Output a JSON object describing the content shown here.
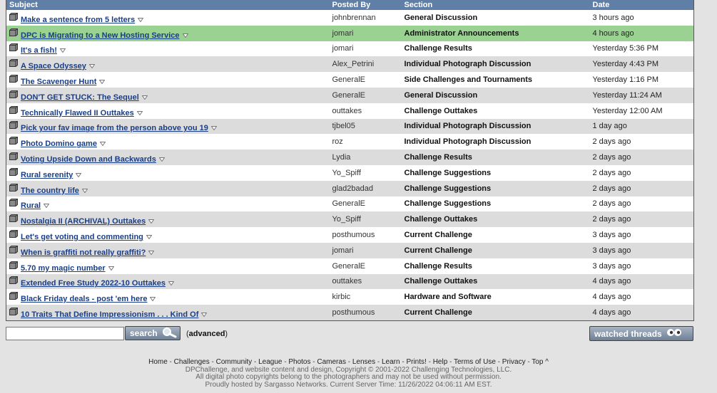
{
  "headers": {
    "subject": "Subject",
    "posted_by": "Posted By",
    "section": "Section",
    "date": "Date"
  },
  "threads": [
    {
      "subject": "Make a sentence from 5 letters",
      "poster": "johnbrennan",
      "section": "General Discussion",
      "date": "3 hours ago"
    },
    {
      "subject": "DPC is Migrating to a New Hosting Service",
      "poster": "jomari",
      "section": "Administrator Announcements",
      "date": "4 hours ago",
      "highlight": true
    },
    {
      "subject": "It's a fish!",
      "poster": "jomari",
      "section": "Challenge Results",
      "date": "Yesterday 5:36 PM"
    },
    {
      "subject": "A Space Odyssey",
      "poster": "Alex_Petrini",
      "section": "Individual Photograph Discussion",
      "date": "Yesterday 4:43 PM"
    },
    {
      "subject": "The Scavenger Hunt",
      "poster": "GeneralE",
      "section": "Side Challenges and Tournaments",
      "date": "Yesterday 1:16 PM"
    },
    {
      "subject": "DON'T GET STUCK: The Sequel",
      "poster": "GeneralE",
      "section": "General Discussion",
      "date": "Yesterday 11:24 AM"
    },
    {
      "subject": "Technically Flawed II Outtakes",
      "poster": "outtakes",
      "section": "Challenge Outtakes",
      "date": "Yesterday 12:00 AM"
    },
    {
      "subject": "Pick your fav image from the person above you 19",
      "poster": "tjbel05",
      "section": "Individual Photograph Discussion",
      "date": "1 day ago"
    },
    {
      "subject": "Photo Domino game",
      "poster": "roz",
      "section": "Individual Photograph Discussion",
      "date": "2 days ago"
    },
    {
      "subject": "Voting Upside Down and Backwards",
      "poster": "Lydia",
      "section": "Challenge Results",
      "date": "2 days ago"
    },
    {
      "subject": "Rural serenity",
      "poster": "Yo_Spiff",
      "section": "Challenge Suggestions",
      "date": "2 days ago"
    },
    {
      "subject": "The country life",
      "poster": "glad2badad",
      "section": "Challenge Suggestions",
      "date": "2 days ago"
    },
    {
      "subject": "Rural",
      "poster": "GeneralE",
      "section": "Challenge Suggestions",
      "date": "2 days ago"
    },
    {
      "subject": "Nostalgia II (ARCHIVAL) Outtakes",
      "poster": "Yo_Spiff",
      "section": "Challenge Outtakes",
      "date": "2 days ago"
    },
    {
      "subject": "Let's get voting and commenting",
      "poster": "posthumous",
      "section": "Current Challenge",
      "date": "3 days ago"
    },
    {
      "subject": "When is graffiti not really graffiti?",
      "poster": "jomari",
      "section": "Current Challenge",
      "date": "3 days ago"
    },
    {
      "subject": "5.70 my magic number",
      "poster": "GeneralE",
      "section": "Challenge Results",
      "date": "3 days ago"
    },
    {
      "subject": "Extended Free Study 2022-10 Outtakes",
      "poster": "outtakes",
      "section": "Challenge Outtakes",
      "date": "4 days ago"
    },
    {
      "subject": "Black Friday deals - post 'em here",
      "poster": "kirbic",
      "section": "Hardware and Software",
      "date": "4 days ago"
    },
    {
      "subject": "10 Traits That Define Impressionism . . . Kind Of",
      "poster": "posthumous",
      "section": "Current Challenge",
      "date": "4 days ago"
    }
  ],
  "search": {
    "value": "",
    "button_label": "search",
    "advanced_open": "(",
    "advanced_label": "advanced",
    "advanced_close": ")"
  },
  "watched": {
    "label": "watched threads"
  },
  "footer": {
    "nav": [
      "Home",
      "Challenges",
      "Community",
      "League",
      "Photos",
      "Cameras",
      "Lenses",
      "Learn",
      "Prints!",
      "Help",
      "Terms of Use",
      "Privacy",
      "Top ^"
    ],
    "copyright": "DPChallenge, and website content and design, Copyright © 2001-2022 Challenging Technologies, LLC.",
    "rights": "All digital photo copyrights belong to the photographers and may not be used without permission.",
    "hosting": "Proudly hosted by Sargasso Networks. Current Server Time: 11/26/2022 04:06:11 AM EST."
  },
  "colors": {
    "header_bg": "#5f7fa6",
    "link": "#1a3e86",
    "highlight_row": "#99d291",
    "alt_row": "#dcdcdc",
    "page_bg": "#e3e3e3"
  },
  "icons": {
    "thread": "folder-icon",
    "menu": "dropdown-triangle-icon",
    "search": "magnifier-icon",
    "watched": "eyes-icon"
  }
}
